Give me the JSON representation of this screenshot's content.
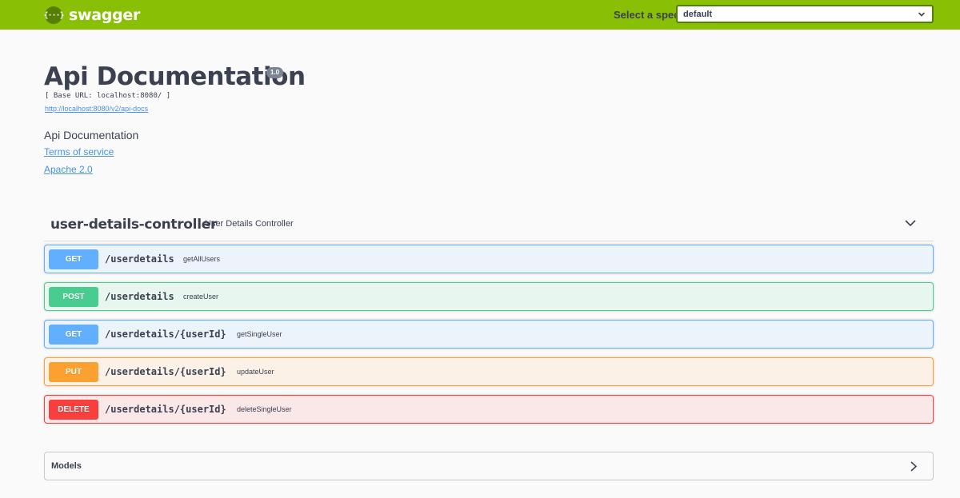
{
  "topbar": {
    "brand_logo": "{···}",
    "brand_name": "swagger",
    "spec_label": "Select a spec",
    "spec_selected": "default",
    "bg_color": "#89bf04"
  },
  "info": {
    "title": "Api Documentation",
    "version": "1.0",
    "base_url": "[ Base URL: localhost:8080/ ]",
    "docs_link": "http://localhost:8080/v2/api-docs",
    "description": "Api Documentation",
    "terms_link": "Terms of service",
    "license_link": "Apache 2.0"
  },
  "tag": {
    "name": "user-details-controller",
    "description": "User Details Controller",
    "toggle_icon": "chevron-down-icon"
  },
  "operations": [
    {
      "method": "GET",
      "path": "/userdetails",
      "summary": "getAllUsers",
      "color": "#61affe"
    },
    {
      "method": "POST",
      "path": "/userdetails",
      "summary": "createUser",
      "color": "#49cc90"
    },
    {
      "method": "GET",
      "path": "/userdetails/{userId}",
      "summary": "getSingleUser",
      "color": "#61affe"
    },
    {
      "method": "PUT",
      "path": "/userdetails/{userId}",
      "summary": "updateUser",
      "color": "#fca130"
    },
    {
      "method": "DELETE",
      "path": "/userdetails/{userId}",
      "summary": "deleteSingleUser",
      "color": "#f93e3e"
    }
  ],
  "models": {
    "title": "Models",
    "toggle_icon": "chevron-right-icon"
  }
}
